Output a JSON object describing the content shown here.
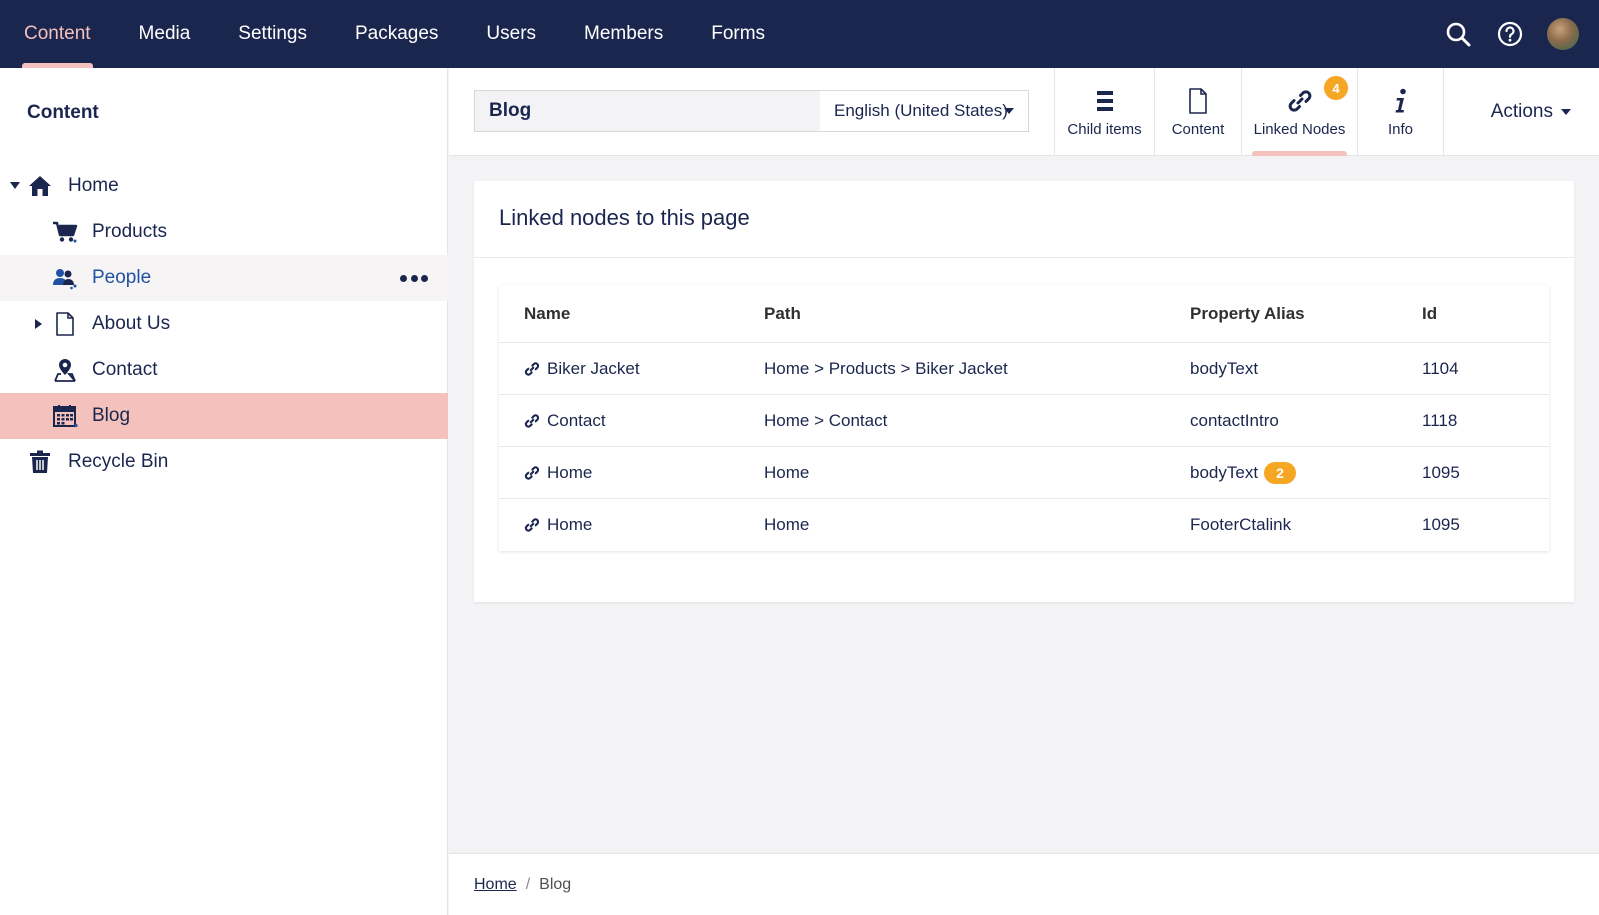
{
  "topnav": {
    "items": [
      {
        "label": "Content",
        "active": true
      },
      {
        "label": "Media"
      },
      {
        "label": "Settings"
      },
      {
        "label": "Packages"
      },
      {
        "label": "Users"
      },
      {
        "label": "Members"
      },
      {
        "label": "Forms"
      }
    ],
    "icons": [
      "search-icon",
      "help-icon",
      "user-avatar"
    ]
  },
  "sidebar": {
    "title": "Content",
    "tree": [
      {
        "label": "Home",
        "icon": "home-icon",
        "expanded": true
      },
      {
        "label": "Products",
        "icon": "shopping-cart-icon"
      },
      {
        "label": "People",
        "icon": "users-icon",
        "state": "hover"
      },
      {
        "label": "About Us",
        "icon": "document-icon",
        "collapsed": true
      },
      {
        "label": "Contact",
        "icon": "map-pin-icon"
      },
      {
        "label": "Blog",
        "icon": "calendar-icon",
        "state": "selected"
      },
      {
        "label": "Recycle Bin",
        "icon": "trash-icon"
      }
    ]
  },
  "editor": {
    "name_value": "Blog",
    "language": "English (United States)",
    "apps": [
      {
        "label": "Child items",
        "icon": "list-icon"
      },
      {
        "label": "Content",
        "icon": "document-icon"
      },
      {
        "label": "Linked Nodes",
        "icon": "link-icon",
        "badge": "4",
        "active": true
      },
      {
        "label": "Info",
        "icon": "info-icon"
      }
    ],
    "actions_label": "Actions"
  },
  "panel": {
    "title": "Linked nodes to this page",
    "columns": {
      "name": "Name",
      "path": "Path",
      "alias": "Property Alias",
      "id": "Id"
    },
    "rows": [
      {
        "name": "Biker Jacket",
        "path": "Home > Products > Biker Jacket",
        "alias": "bodyText",
        "id": "1104"
      },
      {
        "name": "Contact",
        "path": "Home > Contact",
        "alias": "contactIntro",
        "id": "1118"
      },
      {
        "name": "Home",
        "path": "Home",
        "alias": "bodyText",
        "alias_count": "2",
        "id": "1095"
      },
      {
        "name": "Home",
        "path": "Home",
        "alias": "FooterCtalink",
        "id": "1095"
      }
    ]
  },
  "breadcrumb": {
    "items": [
      "Home",
      "Blog"
    ]
  },
  "colors": {
    "nav_bg": "#1b264f",
    "accent_pink": "#f5c1bc",
    "badge_orange": "#f5a623",
    "text_primary": "#1b264f"
  }
}
